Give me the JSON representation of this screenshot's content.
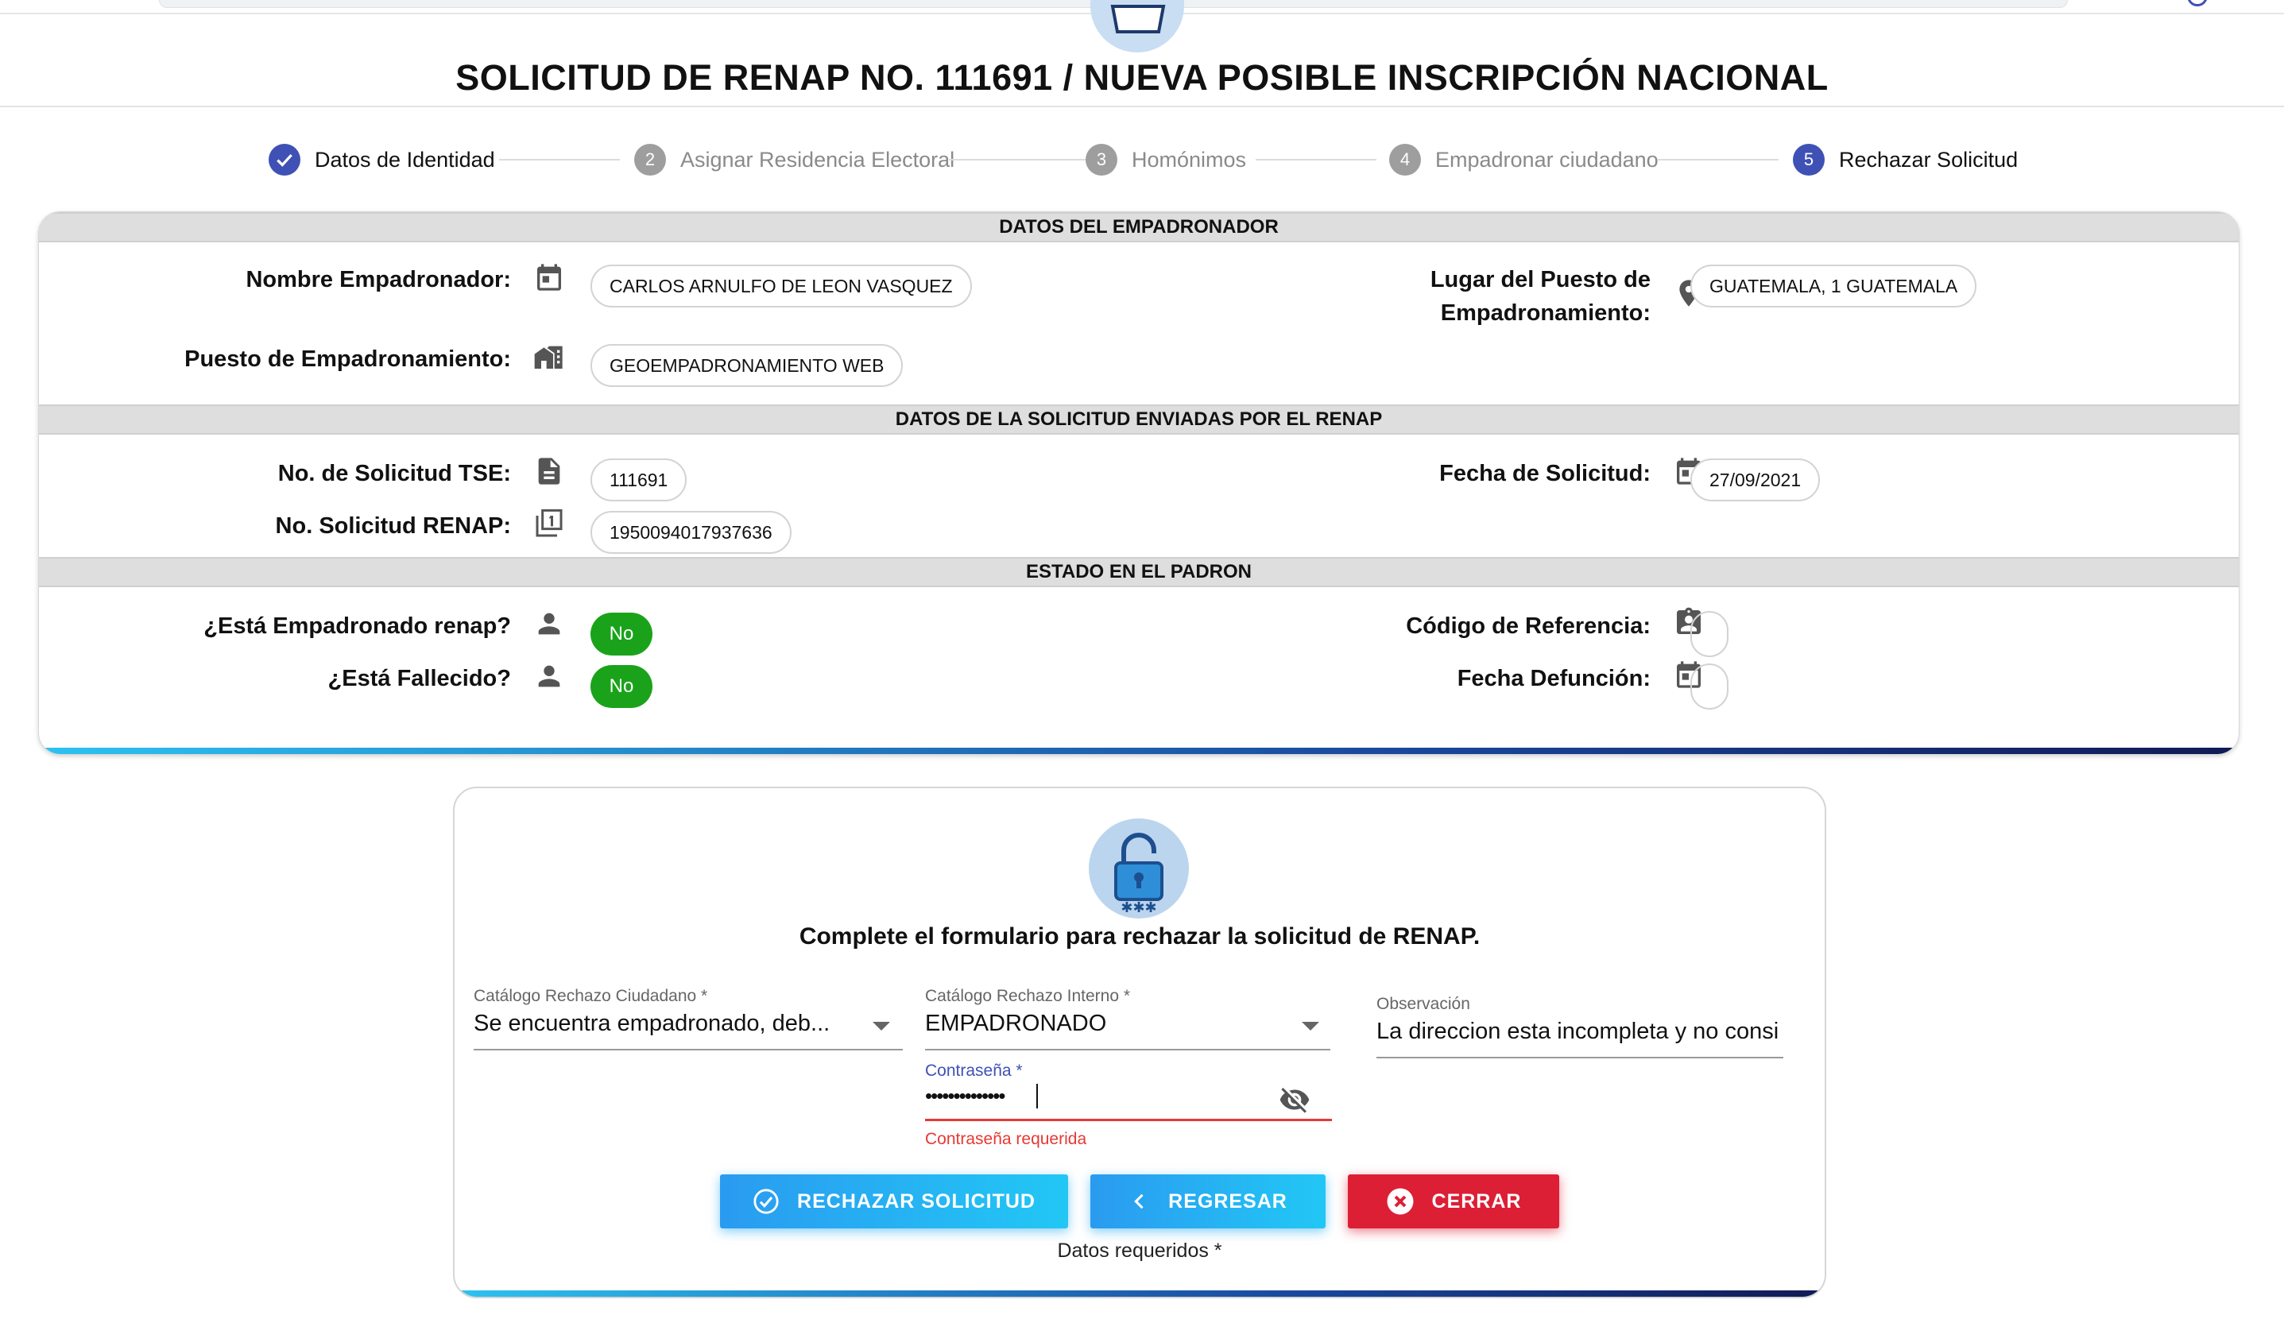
{
  "page": {
    "title": "SOLICITUD DE RENAP NO. 111691 / NUEVA POSIBLE INSCRIPCIÓN NACIONAL"
  },
  "stepper": {
    "steps": [
      {
        "number": "",
        "label": "Datos de Identidad",
        "state": "done"
      },
      {
        "number": "2",
        "label": "Asignar Residencia Electoral",
        "state": "pending"
      },
      {
        "number": "3",
        "label": "Homónimos",
        "state": "pending"
      },
      {
        "number": "4",
        "label": "Empadronar ciudadano",
        "state": "pending"
      },
      {
        "number": "5",
        "label": "Rechazar Solicitud",
        "state": "active"
      }
    ]
  },
  "empadronador": {
    "section_title": "DATOS DEL EMPADRONADOR",
    "nombre_label": "Nombre Empadronador:",
    "nombre_value": "CARLOS ARNULFO DE LEON VASQUEZ",
    "puesto_label": "Puesto de Empadronamiento:",
    "puesto_value": "GEOEMPADRONAMIENTO WEB",
    "lugar_label_1": "Lugar del Puesto de",
    "lugar_label_2": "Empadronamiento:",
    "lugar_value": "GUATEMALA, 1 GUATEMALA"
  },
  "solicitud": {
    "section_title": "DATOS DE LA SOLICITUD ENVIADAS POR EL RENAP",
    "tse_label": "No. de Solicitud TSE:",
    "tse_value": "111691",
    "renap_label": "No. Solicitud RENAP:",
    "renap_value": "1950094017937636",
    "fecha_label": "Fecha de Solicitud:",
    "fecha_value": "27/09/2021"
  },
  "padron": {
    "section_title": "ESTADO EN EL PADRON",
    "empadronado_label": "¿Está Empadronado renap?",
    "empadronado_value": "No",
    "fallecido_label": "¿Está Fallecido?",
    "fallecido_value": "No",
    "codigo_label": "Código de Referencia:",
    "codigo_value": "",
    "defuncion_label": "Fecha Defunción:",
    "defuncion_value": ""
  },
  "form": {
    "instruction": "Complete el formulario para rechazar la solicitud de RENAP.",
    "rechazo_ciudadano_label": "Catálogo Rechazo Ciudadano *",
    "rechazo_ciudadano_value": "Se encuentra empadronado, deb...",
    "rechazo_interno_label": "Catálogo Rechazo Interno *",
    "rechazo_interno_value": "EMPADRONADO",
    "observacion_label": "Observación",
    "observacion_value": "La direccion esta incompleta y no consi",
    "password_label": "Contraseña *",
    "password_value": "••••••••••••••",
    "password_error": "Contraseña requerida",
    "btn_rechazar": "RECHAZAR SOLICITUD",
    "btn_regresar": "REGRESAR",
    "btn_cerrar": "CERRAR",
    "required_note": "Datos requeridos *"
  },
  "colors": {
    "primary": "#3f51b5",
    "success": "#1aa31a",
    "danger": "#dc1f35",
    "accent": "#22c7f5",
    "error_text": "#e53935"
  }
}
